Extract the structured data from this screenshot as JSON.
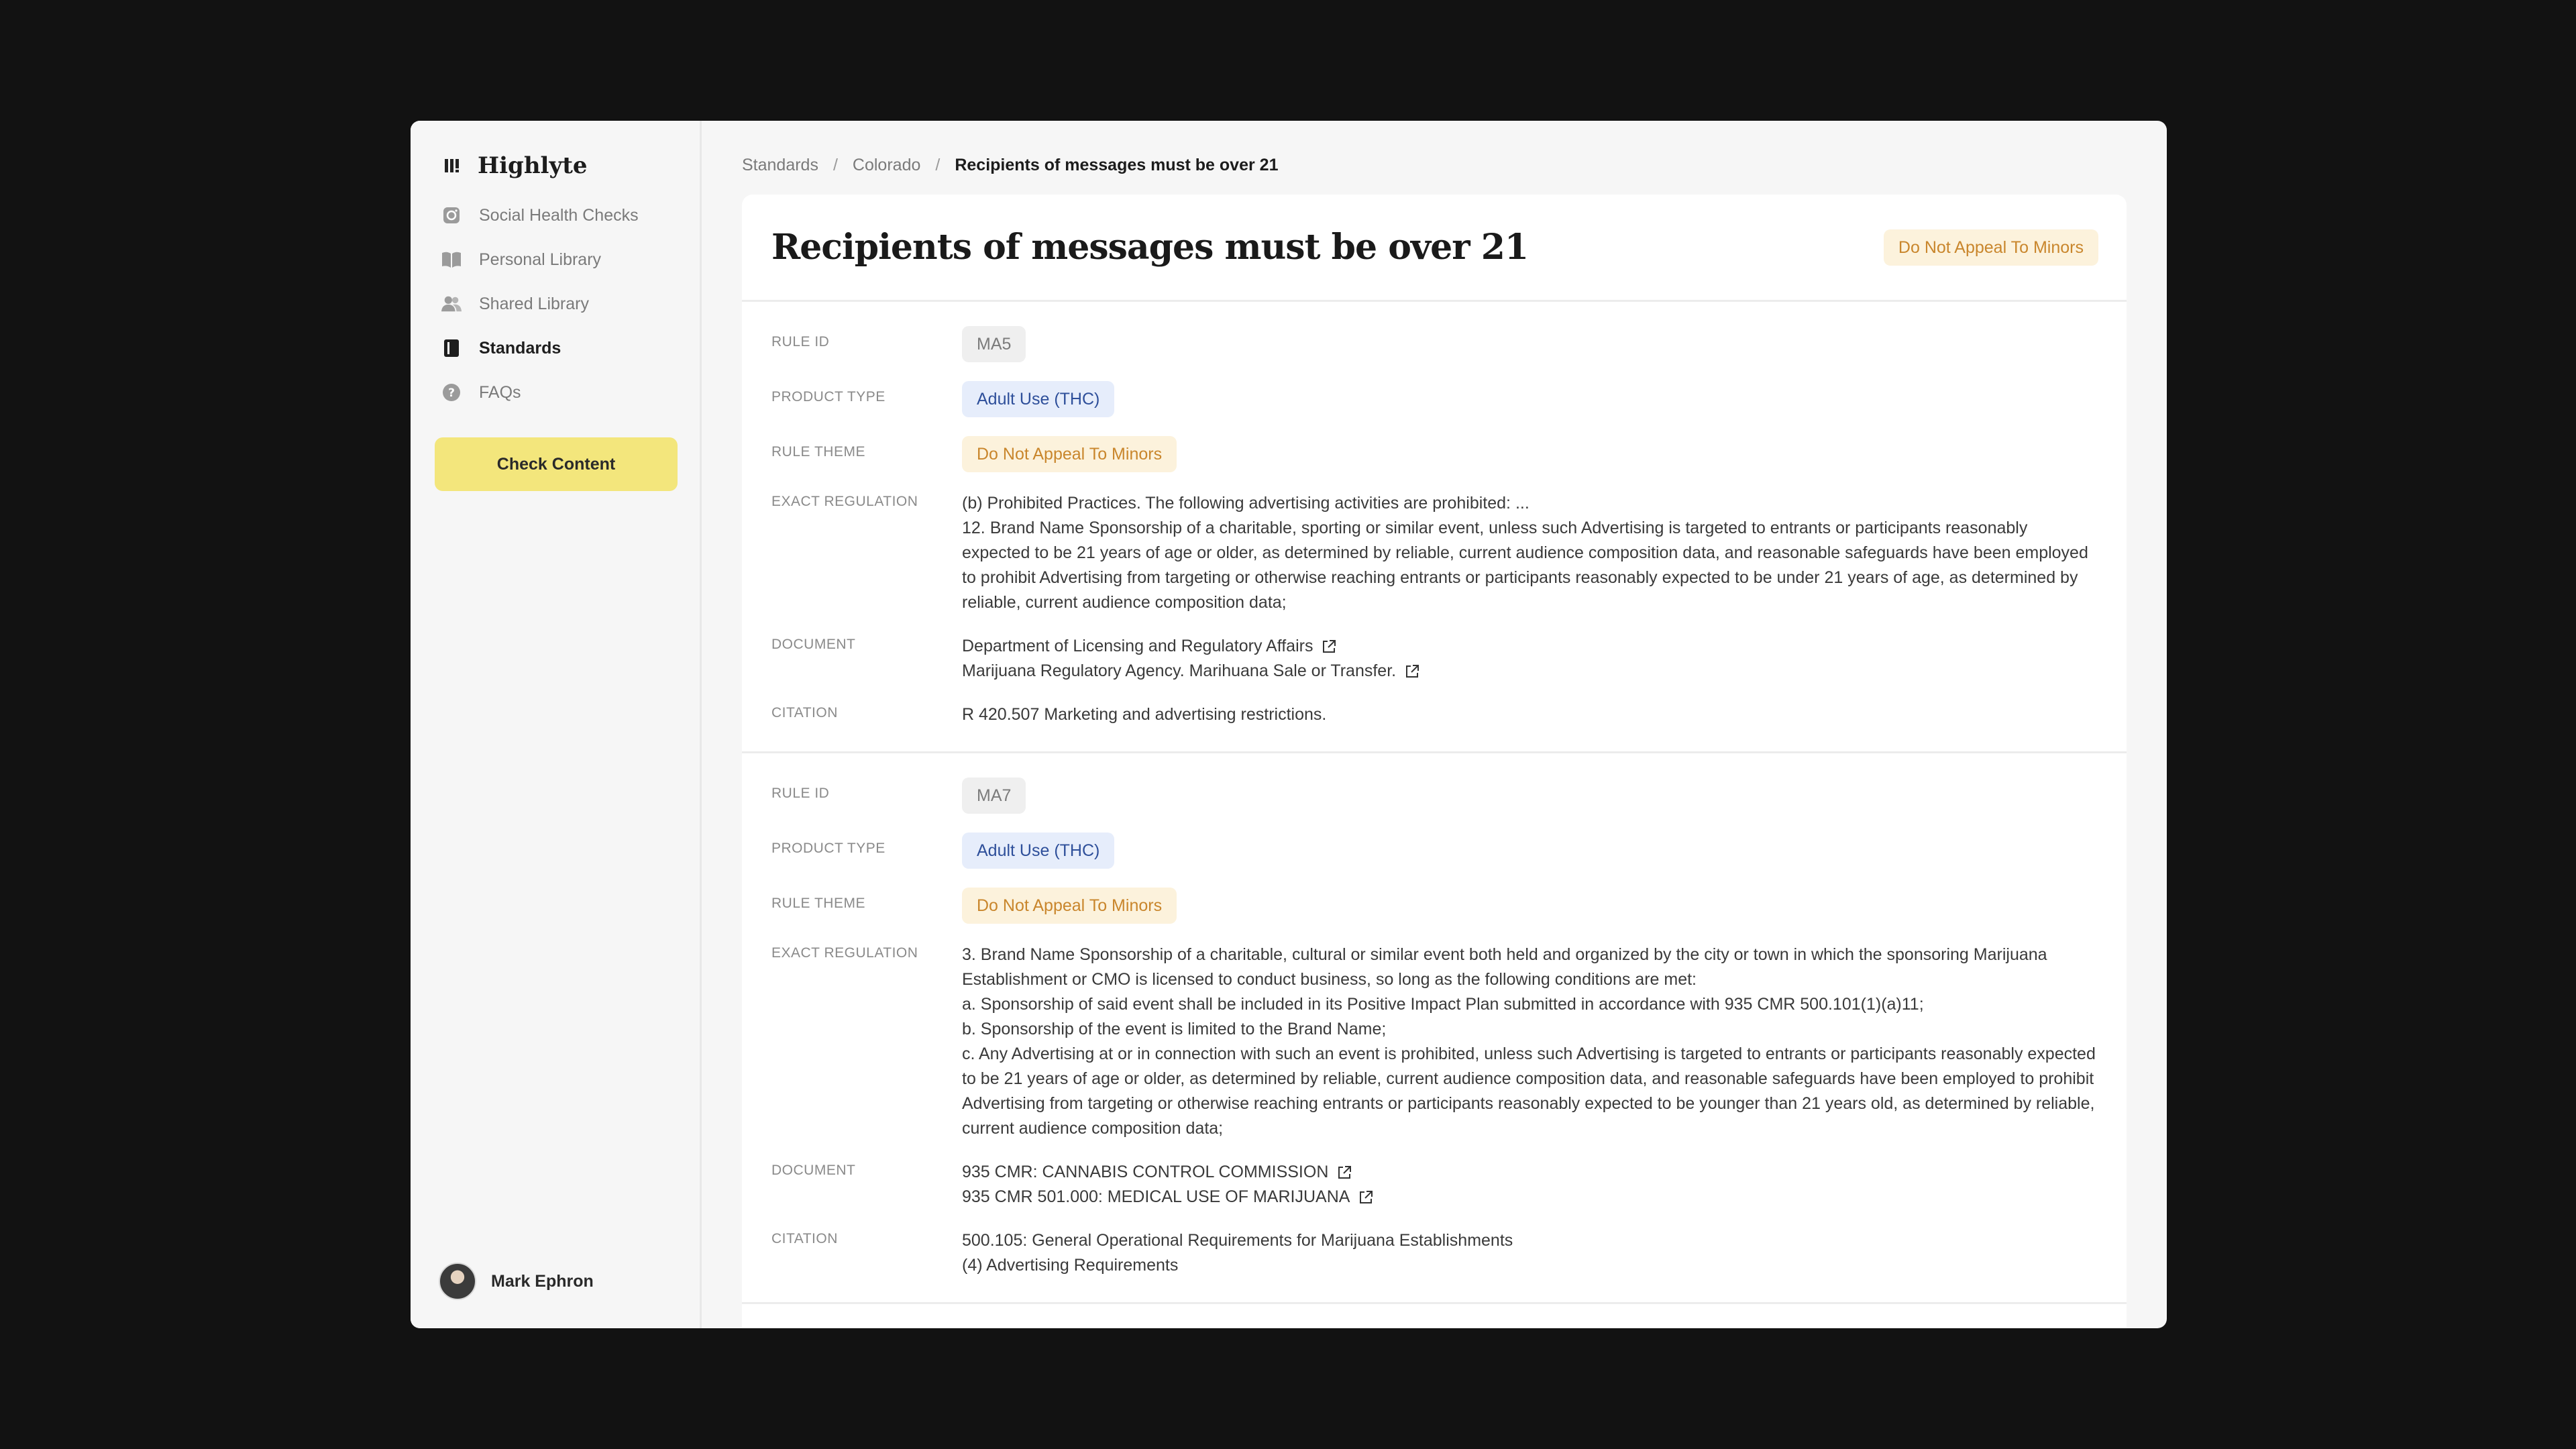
{
  "app": {
    "name": "Highlyte"
  },
  "sidebar": {
    "items": [
      {
        "label": "Social Health Checks",
        "icon": "instagram-icon"
      },
      {
        "label": "Personal Library",
        "icon": "book-open-icon"
      },
      {
        "label": "Shared Library",
        "icon": "users-icon"
      },
      {
        "label": "Standards",
        "icon": "book-icon",
        "active": true
      },
      {
        "label": "FAQs",
        "icon": "help-circle-icon"
      }
    ],
    "cta_label": "Check Content",
    "user_name": "Mark Ephron"
  },
  "breadcrumb": {
    "items": [
      "Standards",
      "Colorado"
    ],
    "current": "Recipients of messages must be over 21"
  },
  "page": {
    "title": "Recipients of messages must be over 21",
    "theme_badge": "Do Not Appeal To Minors"
  },
  "labels": {
    "rule_id": "RULE ID",
    "product_type": "PRODUCT TYPE",
    "rule_theme": "RULE THEME",
    "exact_regulation": "EXACT REGULATION",
    "document": "DOCUMENT",
    "citation": "CITATION"
  },
  "rules": [
    {
      "rule_id": "MA5",
      "product_type": "Adult Use (THC)",
      "rule_theme": "Do Not Appeal To Minors",
      "regulation": [
        "(b) Prohibited Practices. The following advertising activities are prohibited: ...",
        "12. Brand Name Sponsorship of a charitable, sporting or similar event, unless such Advertising is targeted to entrants or participants reasonably expected to be 21 years of age or older, as determined by reliable, current audience composition data, and reasonable safeguards have been employed to prohibit Advertising from targeting or otherwise reaching entrants or participants reasonably expected to be under 21 years of age, as determined by reliable, current audience composition data;"
      ],
      "documents": [
        "Department of Licensing and Regulatory Affairs",
        "Marijuana Regulatory Agency. Marihuana Sale or Transfer."
      ],
      "citation": [
        "R 420.507 Marketing and advertising restrictions."
      ]
    },
    {
      "rule_id": "MA7",
      "product_type": "Adult Use (THC)",
      "rule_theme": "Do Not Appeal To Minors",
      "regulation": [
        "3. Brand Name Sponsorship of a charitable, cultural or similar event both held and organized by the city or town in which the sponsoring Marijuana Establishment or CMO is licensed to conduct business, so long as the following conditions are met:",
        "a. Sponsorship of said event shall be included in its Positive Impact Plan submitted in accordance with 935 CMR 500.101(1)(a)11;",
        "b. Sponsorship of the event is limited to the Brand Name;",
        "c. Any Advertising at or in connection with such an event is prohibited, unless such Advertising is targeted to entrants or participants reasonably expected to be 21 years of age or older, as determined by reliable, current audience composition data, and reasonable safeguards have been employed to prohibit Advertising from targeting or otherwise reaching entrants or participants reasonably expected to be younger than 21 years old, as determined by reliable, current audience composition data;"
      ],
      "documents": [
        "935 CMR: CANNABIS CONTROL COMMISSION",
        "935 CMR 501.000: MEDICAL USE OF MARIJUANA"
      ],
      "citation": [
        "500.105: General Operational Requirements for Marijuana Establishments",
        "(4) Advertising Requirements"
      ]
    }
  ]
}
